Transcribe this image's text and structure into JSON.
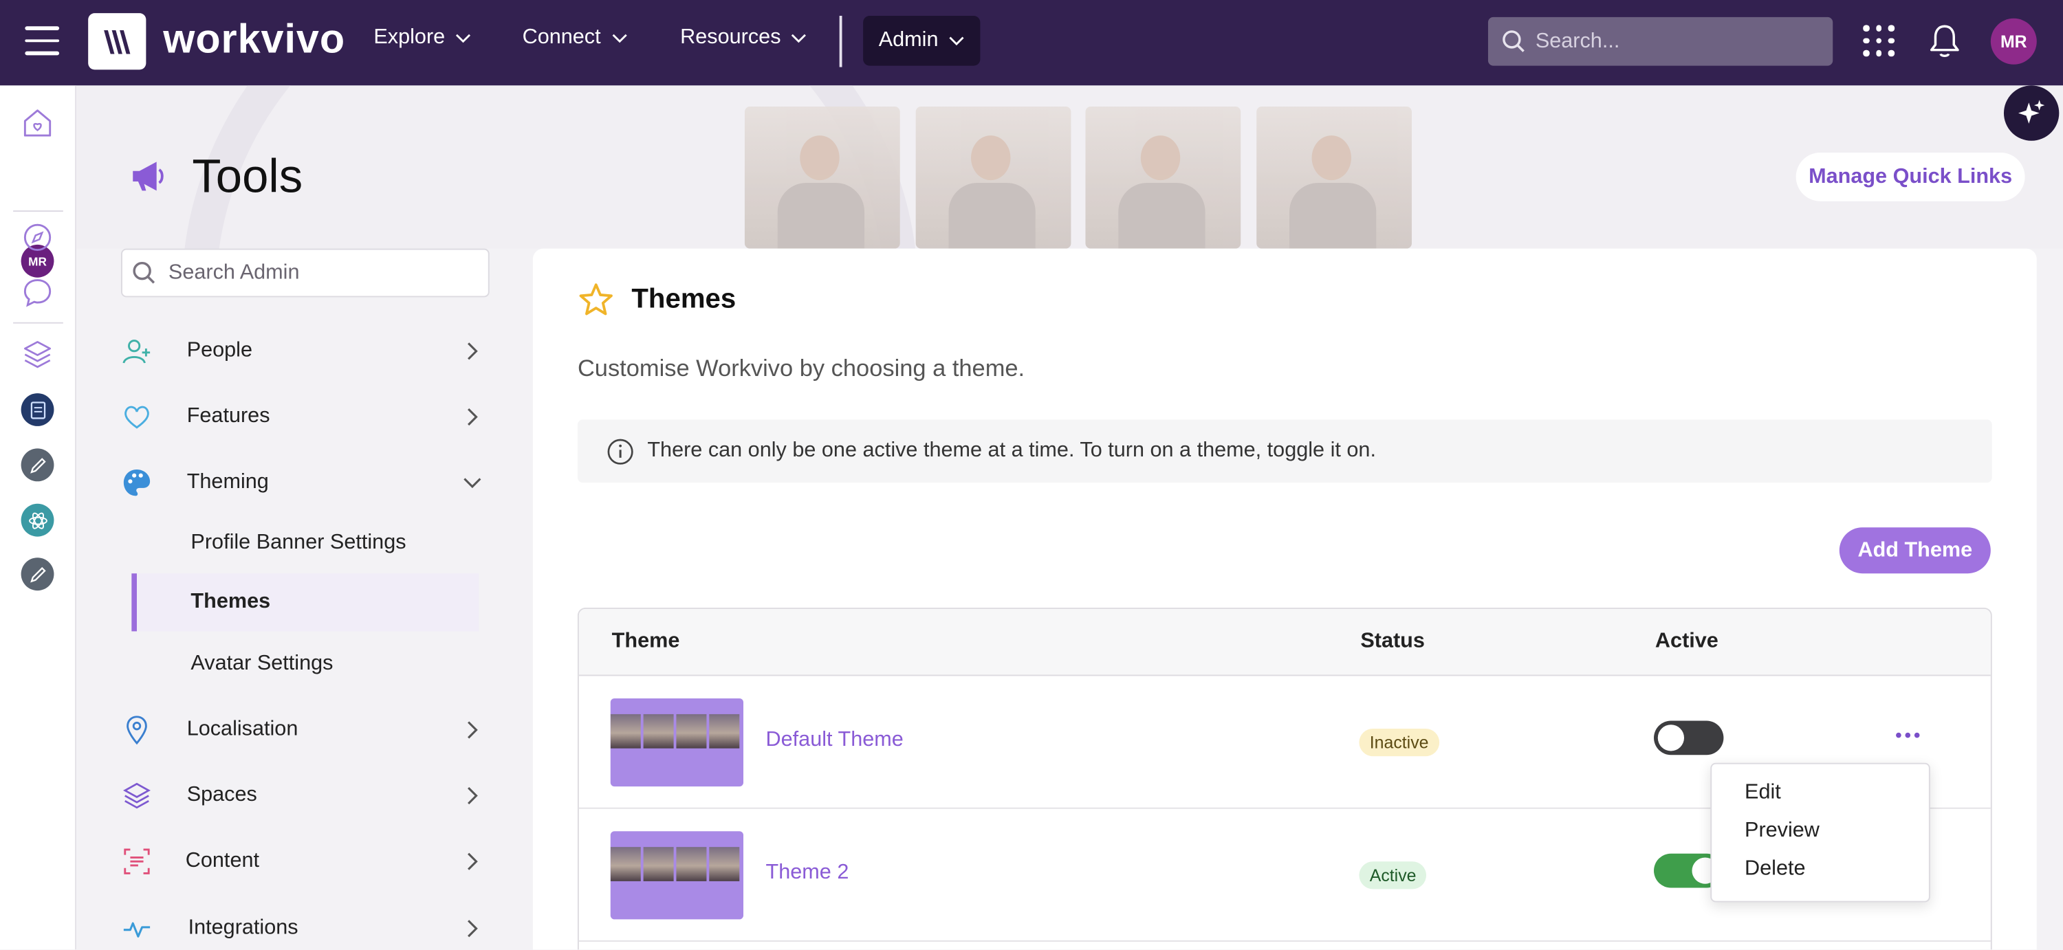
{
  "topbar": {
    "logo_text": "workvivo",
    "nav": [
      {
        "label": "Explore"
      },
      {
        "label": "Connect"
      },
      {
        "label": "Resources"
      }
    ],
    "admin_label": "Admin",
    "search_placeholder": "Search...",
    "avatar_initials": "MR"
  },
  "rail": {
    "avatar_initials": "MR",
    "icons": [
      "home-icon",
      "avatar",
      "compass-icon",
      "chat-icon",
      "layers-icon",
      "space-badge-icon",
      "edit-badge-icon",
      "atom-badge-icon",
      "edit-badge-icon-2"
    ]
  },
  "page": {
    "title": "Tools",
    "quick_links_label": "Manage Quick Links"
  },
  "admin_menu": {
    "search_placeholder": "Search Admin",
    "items": [
      {
        "label": "People"
      },
      {
        "label": "Features"
      },
      {
        "label": "Theming"
      },
      {
        "label": "Localisation"
      },
      {
        "label": "Spaces"
      },
      {
        "label": "Content"
      },
      {
        "label": "Integrations"
      }
    ],
    "theming_sub": [
      {
        "label": "Profile Banner Settings"
      },
      {
        "label": "Themes"
      },
      {
        "label": "Avatar Settings"
      }
    ],
    "active_sub": "Themes"
  },
  "themes": {
    "title": "Themes",
    "description": "Customise Workvivo by choosing a theme.",
    "info": "There can only be one active theme at a time. To turn on a theme, toggle it on.",
    "add_label": "Add Theme",
    "columns": [
      "Theme",
      "Status",
      "Active"
    ],
    "rows": [
      {
        "name": "Default Theme",
        "status": "Inactive",
        "active": false
      },
      {
        "name": "Theme 2",
        "status": "Active",
        "active": true
      }
    ],
    "row_menu": [
      "Edit",
      "Preview",
      "Delete"
    ]
  },
  "colors": {
    "topbar": "#332150",
    "accent": "#a073e0",
    "link": "#8a5bd6",
    "toggle_on": "#3f9e4b"
  }
}
